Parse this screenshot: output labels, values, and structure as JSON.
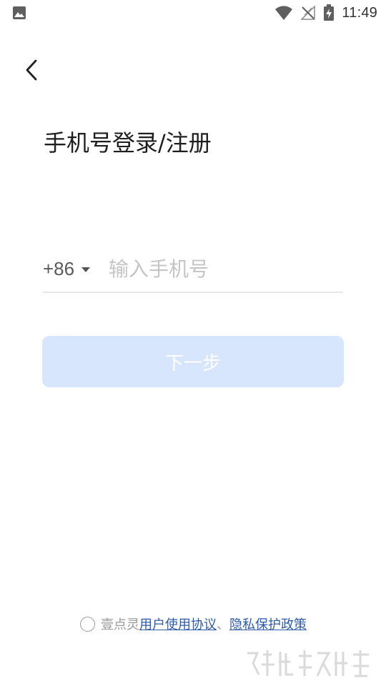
{
  "status_bar": {
    "time": "11:49",
    "left_icon": "image-icon",
    "icons": [
      "wifi-icon",
      "no-signal-icon",
      "battery-charging-icon"
    ]
  },
  "nav": {
    "back_icon": "back-chevron-icon"
  },
  "page": {
    "title": "手机号登录/注册"
  },
  "phone": {
    "country_code": "+86",
    "value": "",
    "placeholder": "输入手机号"
  },
  "next_button": {
    "label": "下一步",
    "background": "#d7e6fc",
    "text_color": "#ffffff"
  },
  "agreement": {
    "checked": false,
    "prefix": "壹点灵",
    "user_agreement": "用户使用协议",
    "separator": "、",
    "privacy_policy": "隐私保护政策",
    "link_color": "#2f5ba8"
  }
}
